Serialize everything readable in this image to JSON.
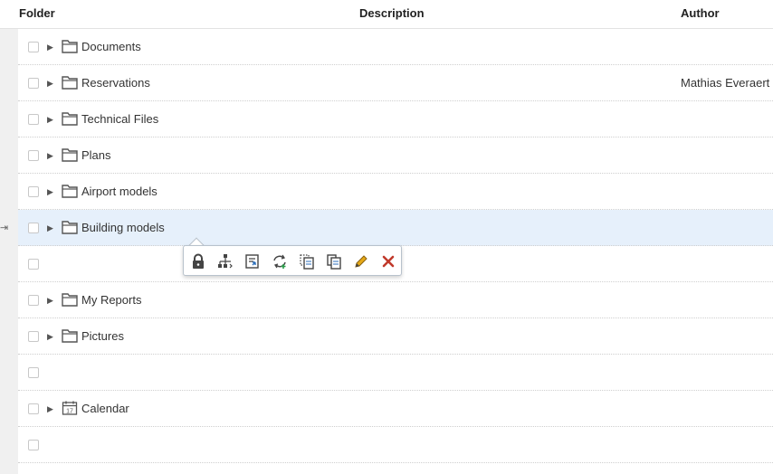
{
  "header": {
    "folder": "Folder",
    "description": "Description",
    "author": "Author"
  },
  "rows": [
    {
      "name": "Documents",
      "author": "",
      "icon": "folder-icon",
      "expandable": true
    },
    {
      "name": "Reservations",
      "author": "Mathias Everaert",
      "icon": "folder-icon",
      "expandable": true
    },
    {
      "name": "Technical Files",
      "author": "",
      "icon": "folder-icon",
      "expandable": true
    },
    {
      "name": "Plans",
      "author": "",
      "icon": "folder-icon",
      "expandable": true
    },
    {
      "name": "Airport models",
      "author": "",
      "icon": "folder-icon",
      "expandable": true
    },
    {
      "name": "Building models",
      "author": "",
      "icon": "folder-icon",
      "expandable": true,
      "selected": true
    },
    {
      "name": "",
      "author": "",
      "icon": "",
      "expandable": false
    },
    {
      "name": "My Reports",
      "author": "",
      "icon": "folder-icon",
      "expandable": true
    },
    {
      "name": "Pictures",
      "author": "",
      "icon": "folder-icon",
      "expandable": true
    },
    {
      "name": "",
      "author": "",
      "icon": "",
      "expandable": false
    },
    {
      "name": "Calendar",
      "author": "",
      "icon": "calendar-icon",
      "calendar_day": "17",
      "expandable": true
    },
    {
      "name": "",
      "author": "",
      "icon": "",
      "expandable": false
    }
  ],
  "toolbar": {
    "actions": [
      "lock-icon",
      "hierarchy-icon",
      "document-link-icon",
      "refresh-add-icon",
      "copy-dotted-icon",
      "copy-icon",
      "edit-pencil-icon",
      "delete-x-icon"
    ]
  },
  "colors": {
    "selected_row": "#e6f0fb",
    "delete": "#c0392b",
    "pencil": "#e6a817",
    "icon": "#555555"
  }
}
